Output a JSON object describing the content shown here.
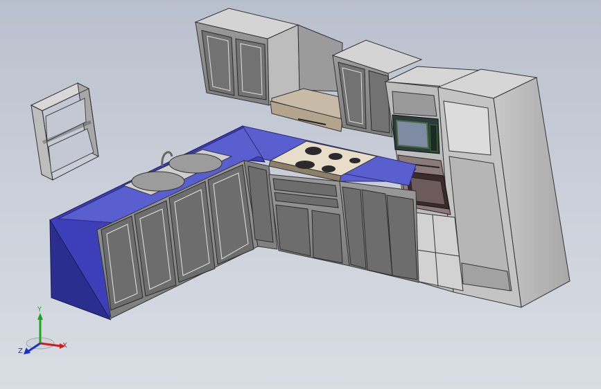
{
  "scene": {
    "model": "kitchen-assembly",
    "countertop_color": "#5a5fd0",
    "cabinet_color": "#8e8e8e",
    "panel_color": "#6b6b6b",
    "background_top": "#b9c0cd",
    "background_bottom": "#d9dde4"
  },
  "triad": {
    "x_label": "X",
    "y_label": "Y",
    "z_label": "Z",
    "x_color": "#d11a1a",
    "y_color": "#1ea51e",
    "z_color": "#1a2fd1"
  }
}
